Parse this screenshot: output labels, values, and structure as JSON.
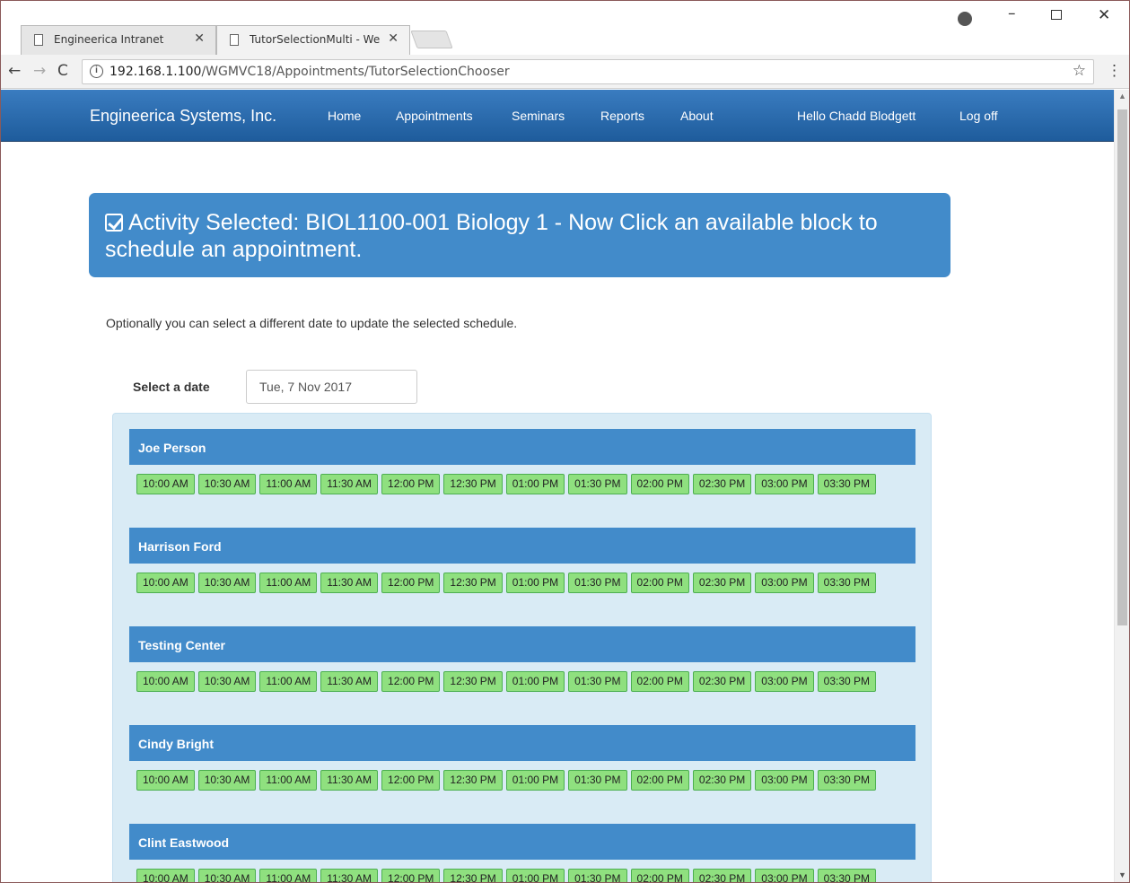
{
  "browser": {
    "tabs": [
      {
        "title": "Engineerica Intranet",
        "active": false
      },
      {
        "title": "TutorSelectionMulti - We",
        "active": true
      }
    ],
    "url_host": "192.168.1.100",
    "url_path": "/WGMVC18/Appointments/TutorSelectionChooser"
  },
  "site": {
    "brand": "Engineerica Systems, Inc.",
    "nav": [
      "Home",
      "Appointments",
      "Seminars",
      "Reports",
      "About"
    ],
    "greeting": "Hello Chadd Blodgett",
    "logoff": "Log off"
  },
  "alert": {
    "text": "Activity Selected: BIOL1100-001 Biology 1 - Now Click an available block to schedule an appointment."
  },
  "hint": "Optionally you can select a different date to update the selected schedule.",
  "date": {
    "label": "Select a date",
    "value": "Tue, 7 Nov 2017"
  },
  "tutors": [
    {
      "name": "Joe Person"
    },
    {
      "name": "Harrison Ford"
    },
    {
      "name": "Testing Center"
    },
    {
      "name": "Cindy Bright"
    },
    {
      "name": "Clint Eastwood"
    }
  ],
  "slots": [
    "10:00 AM",
    "10:30 AM",
    "11:00 AM",
    "11:30 AM",
    "12:00 PM",
    "12:30 PM",
    "01:00 PM",
    "01:30 PM",
    "02:00 PM",
    "02:30 PM",
    "03:00 PM",
    "03:30 PM"
  ],
  "colors": {
    "navbar": "#2a6db0",
    "alert": "#428bca",
    "slot": "#8fe07f",
    "panel": "#d9ebf5"
  }
}
